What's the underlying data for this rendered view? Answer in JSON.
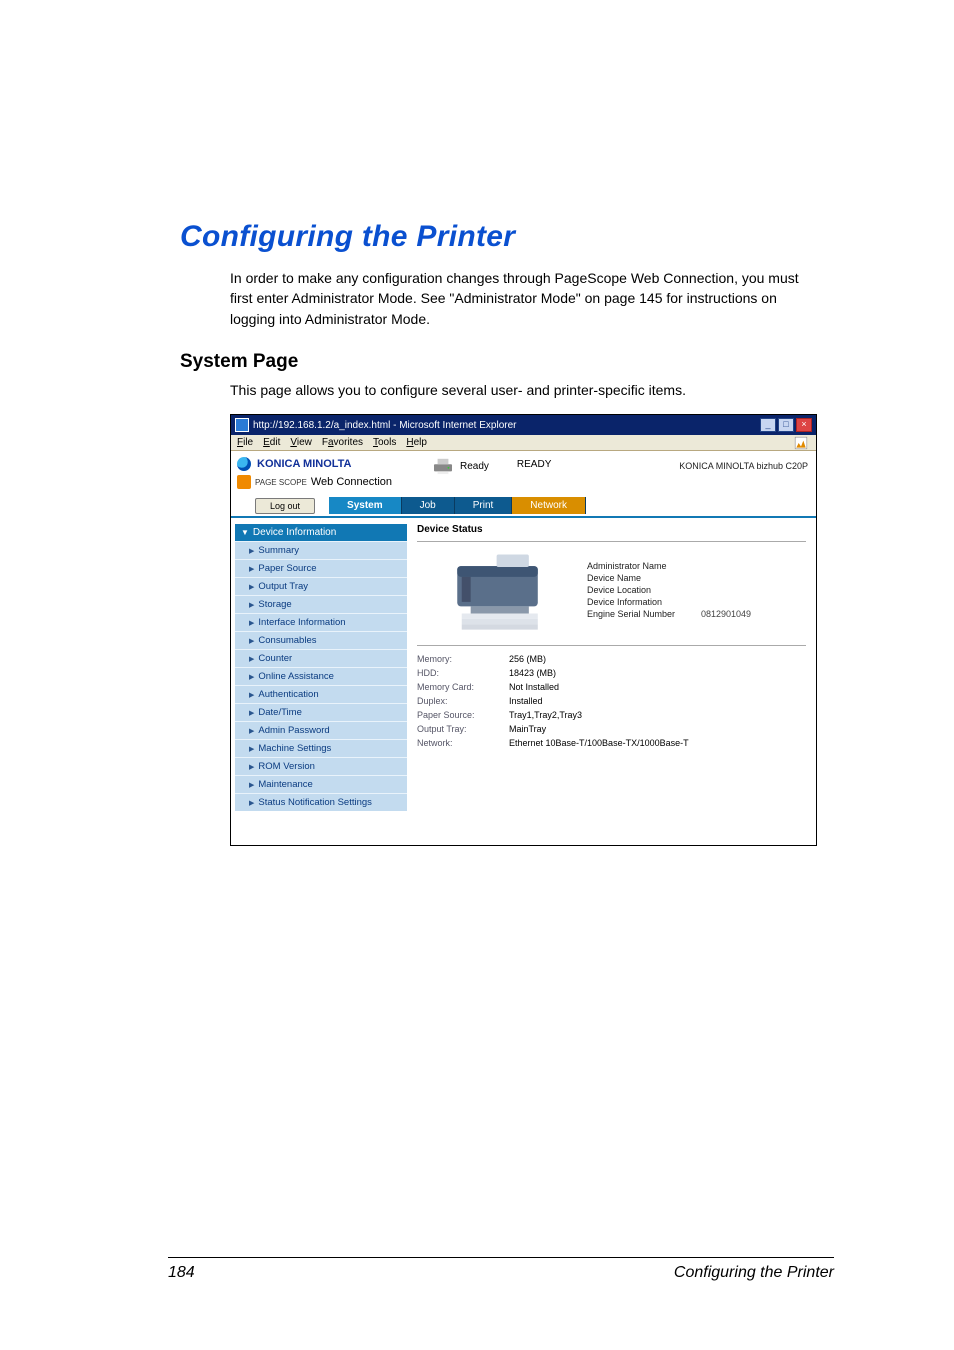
{
  "document": {
    "h1": "Configuring the Printer",
    "p1": "In order to make any configuration changes through PageScope Web Connection, you must first enter Administrator Mode. See \"Administrator Mode\" on page 145 for instructions on logging into Administrator Mode.",
    "h2": "System Page",
    "p2": "This page allows you to configure several user- and printer-specific items.",
    "footer_page": "184",
    "footer_right": "Configuring the Printer"
  },
  "browser": {
    "title": "http://192.168.1.2/a_index.html - Microsoft Internet Explorer",
    "menubar": [
      "File",
      "Edit",
      "View",
      "Favorites",
      "Tools",
      "Help"
    ],
    "underlines": [
      "F",
      "E",
      "V",
      "a",
      "T",
      "H"
    ],
    "window_btn_min": "_",
    "window_btn_max": "□",
    "window_btn_close": "×"
  },
  "header": {
    "brand": "KONICA MINOLTA",
    "product_small": "PAGE SCOPE",
    "product": "Web Connection",
    "status_label": "Ready",
    "status_value": "READY",
    "model": "KONICA MINOLTA bizhub C20P",
    "logout": "Log out"
  },
  "tabs": {
    "items": [
      "System",
      "Job",
      "Print",
      "Network"
    ],
    "active_index": 0,
    "orange_index": 3
  },
  "sidebar": {
    "group": "Device Information",
    "items": [
      "Summary",
      "Paper Source",
      "Output Tray",
      "Storage",
      "Interface Information",
      "Consumables"
    ],
    "items2": [
      "Counter",
      "Online Assistance",
      "Authentication",
      "Date/Time",
      "Admin Password",
      "Machine Settings",
      "ROM Version",
      "Maintenance",
      "Status Notification Settings"
    ]
  },
  "content": {
    "title": "Device Status",
    "hero_fields": [
      {
        "k": "Administrator Name",
        "v": ""
      },
      {
        "k": "Device Name",
        "v": ""
      },
      {
        "k": "Device Location",
        "v": ""
      },
      {
        "k": "Device Information",
        "v": ""
      },
      {
        "k": "Engine Serial Number",
        "v": "0812901049"
      }
    ],
    "specs": [
      {
        "k": "Memory:",
        "v": "256 (MB)"
      },
      {
        "k": "HDD:",
        "v": "18423 (MB)"
      },
      {
        "k": "Memory Card:",
        "v": "Not Installed"
      },
      {
        "k": "Duplex:",
        "v": "Installed"
      },
      {
        "k": "Paper Source:",
        "v": "Tray1,Tray2,Tray3"
      },
      {
        "k": "Output Tray:",
        "v": "MainTray"
      },
      {
        "k": "Network:",
        "v": "Ethernet 10Base-T/100Base-TX/1000Base-T"
      }
    ]
  }
}
